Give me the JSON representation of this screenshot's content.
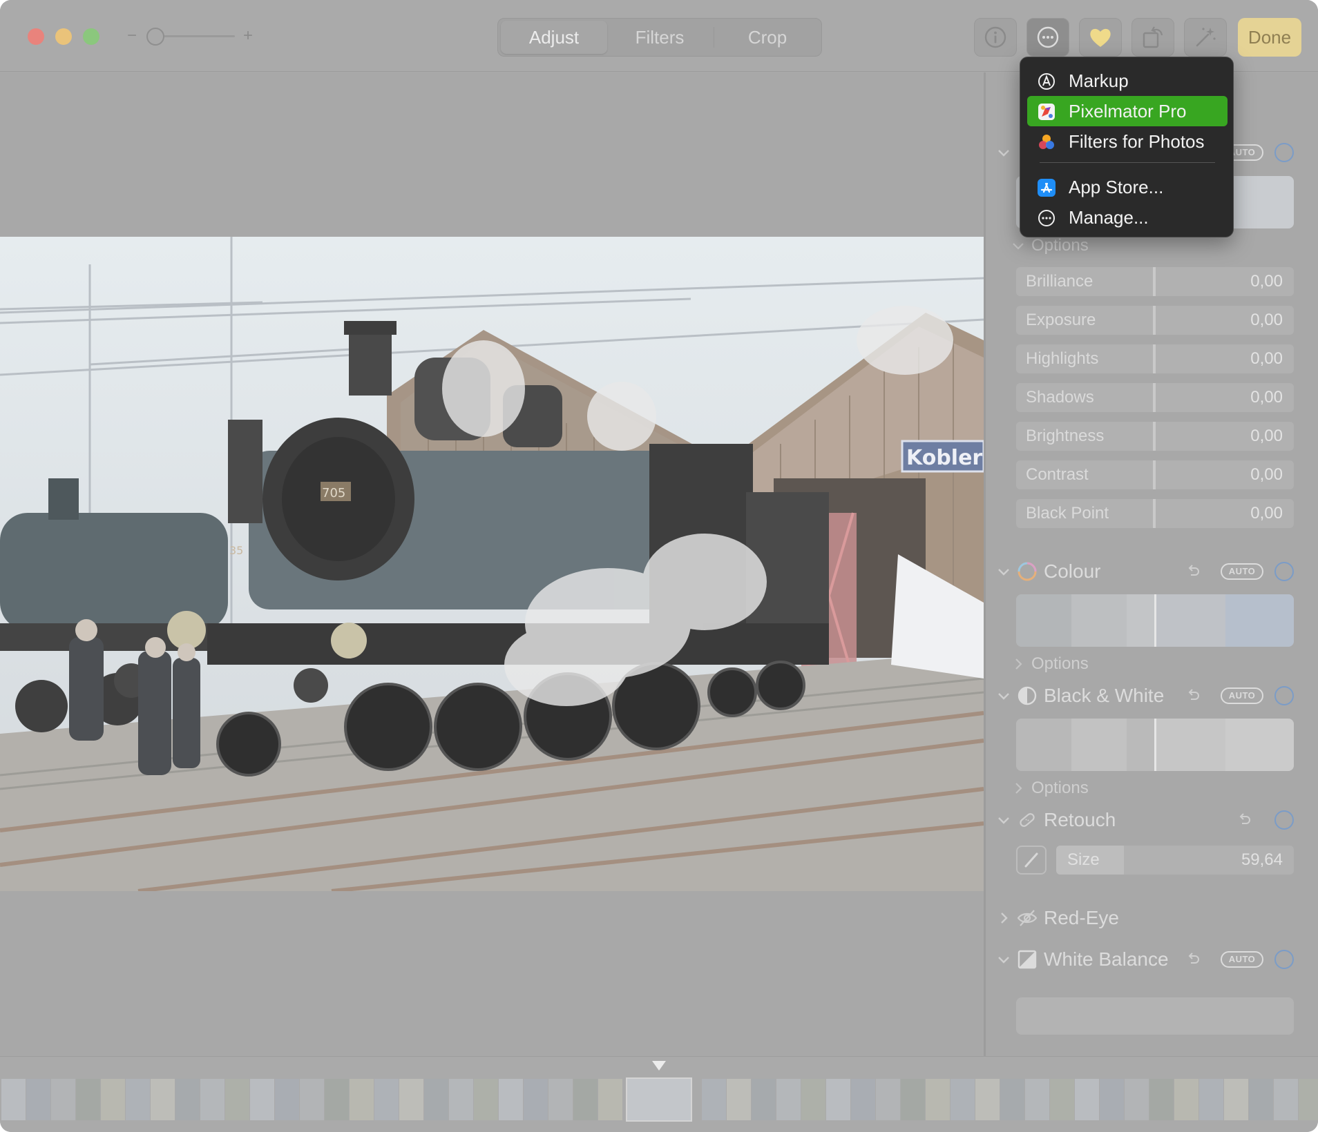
{
  "toolbar": {
    "tabs": [
      {
        "label": "Adjust",
        "active": true
      },
      {
        "label": "Filters",
        "active": false
      },
      {
        "label": "Crop",
        "active": false
      }
    ],
    "zoom_minus": "−",
    "zoom_plus": "+",
    "icons": [
      "info-icon",
      "more-icon",
      "favorite-heart-icon",
      "rotate-icon",
      "auto-enhance-icon"
    ],
    "done_label": "Done"
  },
  "menu": {
    "items": [
      {
        "label": "Markup",
        "icon": "markup-icon",
        "selected": false
      },
      {
        "label": "Pixelmator Pro",
        "icon": "pixelmator-pro-icon",
        "selected": true
      },
      {
        "label": "Filters for Photos",
        "icon": "filters-for-photos-icon",
        "selected": false
      },
      {
        "label": "App Store...",
        "icon": "app-store-icon",
        "selected": false
      },
      {
        "label": "Manage...",
        "icon": "manage-icon",
        "selected": false
      }
    ]
  },
  "sidebar": {
    "light": {
      "auto_label": "AUTO",
      "options_label": "Options",
      "sliders": [
        {
          "name": "Brilliance",
          "value": "0,00"
        },
        {
          "name": "Exposure",
          "value": "0,00"
        },
        {
          "name": "Highlights",
          "value": "0,00"
        },
        {
          "name": "Shadows",
          "value": "0,00"
        },
        {
          "name": "Brightness",
          "value": "0,00"
        },
        {
          "name": "Contrast",
          "value": "0,00"
        },
        {
          "name": "Black Point",
          "value": "0,00"
        }
      ]
    },
    "colour": {
      "title": "Colour",
      "auto_label": "AUTO",
      "options_label": "Options"
    },
    "black_white": {
      "title": "Black & White",
      "auto_label": "AUTO",
      "options_label": "Options"
    },
    "retouch": {
      "title": "Retouch",
      "size_label": "Size",
      "size_value": "59,64"
    },
    "red_eye": {
      "title": "Red-Eye"
    },
    "white_balance": {
      "title": "White Balance",
      "auto_label": "AUTO"
    }
  },
  "photo": {
    "sign_text": "Kobler",
    "loco_number": "705",
    "second_loco_number": "35"
  },
  "colors": {
    "accent_selected": "#38a621",
    "toggle_ring": "#7b9cc7",
    "done_bg": "#e5d395"
  }
}
